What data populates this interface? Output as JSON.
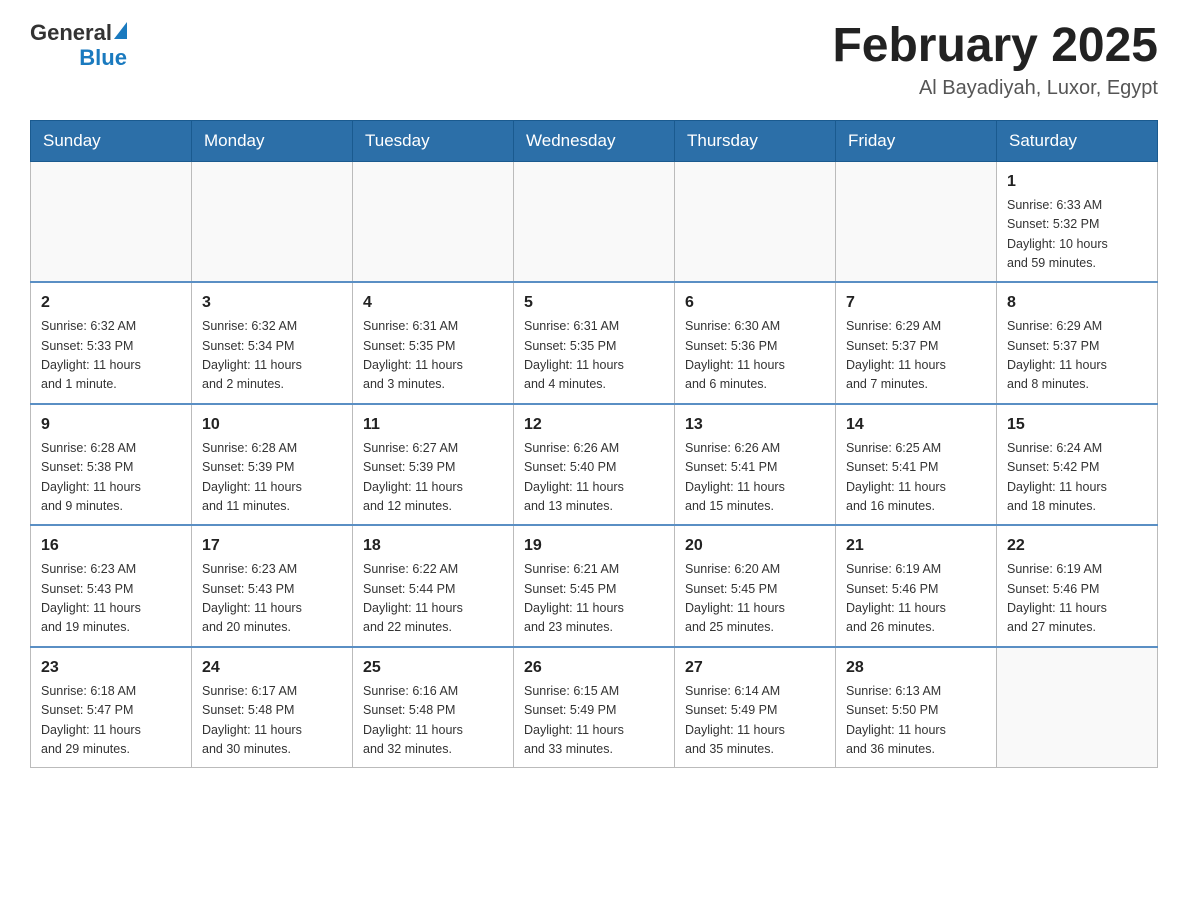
{
  "logo": {
    "general": "General",
    "blue": "Blue"
  },
  "title": {
    "month": "February 2025",
    "location": "Al Bayadiyah, Luxor, Egypt"
  },
  "weekdays": [
    "Sunday",
    "Monday",
    "Tuesday",
    "Wednesday",
    "Thursday",
    "Friday",
    "Saturday"
  ],
  "weeks": [
    [
      {
        "day": "",
        "info": ""
      },
      {
        "day": "",
        "info": ""
      },
      {
        "day": "",
        "info": ""
      },
      {
        "day": "",
        "info": ""
      },
      {
        "day": "",
        "info": ""
      },
      {
        "day": "",
        "info": ""
      },
      {
        "day": "1",
        "info": "Sunrise: 6:33 AM\nSunset: 5:32 PM\nDaylight: 10 hours\nand 59 minutes."
      }
    ],
    [
      {
        "day": "2",
        "info": "Sunrise: 6:32 AM\nSunset: 5:33 PM\nDaylight: 11 hours\nand 1 minute."
      },
      {
        "day": "3",
        "info": "Sunrise: 6:32 AM\nSunset: 5:34 PM\nDaylight: 11 hours\nand 2 minutes."
      },
      {
        "day": "4",
        "info": "Sunrise: 6:31 AM\nSunset: 5:35 PM\nDaylight: 11 hours\nand 3 minutes."
      },
      {
        "day": "5",
        "info": "Sunrise: 6:31 AM\nSunset: 5:35 PM\nDaylight: 11 hours\nand 4 minutes."
      },
      {
        "day": "6",
        "info": "Sunrise: 6:30 AM\nSunset: 5:36 PM\nDaylight: 11 hours\nand 6 minutes."
      },
      {
        "day": "7",
        "info": "Sunrise: 6:29 AM\nSunset: 5:37 PM\nDaylight: 11 hours\nand 7 minutes."
      },
      {
        "day": "8",
        "info": "Sunrise: 6:29 AM\nSunset: 5:37 PM\nDaylight: 11 hours\nand 8 minutes."
      }
    ],
    [
      {
        "day": "9",
        "info": "Sunrise: 6:28 AM\nSunset: 5:38 PM\nDaylight: 11 hours\nand 9 minutes."
      },
      {
        "day": "10",
        "info": "Sunrise: 6:28 AM\nSunset: 5:39 PM\nDaylight: 11 hours\nand 11 minutes."
      },
      {
        "day": "11",
        "info": "Sunrise: 6:27 AM\nSunset: 5:39 PM\nDaylight: 11 hours\nand 12 minutes."
      },
      {
        "day": "12",
        "info": "Sunrise: 6:26 AM\nSunset: 5:40 PM\nDaylight: 11 hours\nand 13 minutes."
      },
      {
        "day": "13",
        "info": "Sunrise: 6:26 AM\nSunset: 5:41 PM\nDaylight: 11 hours\nand 15 minutes."
      },
      {
        "day": "14",
        "info": "Sunrise: 6:25 AM\nSunset: 5:41 PM\nDaylight: 11 hours\nand 16 minutes."
      },
      {
        "day": "15",
        "info": "Sunrise: 6:24 AM\nSunset: 5:42 PM\nDaylight: 11 hours\nand 18 minutes."
      }
    ],
    [
      {
        "day": "16",
        "info": "Sunrise: 6:23 AM\nSunset: 5:43 PM\nDaylight: 11 hours\nand 19 minutes."
      },
      {
        "day": "17",
        "info": "Sunrise: 6:23 AM\nSunset: 5:43 PM\nDaylight: 11 hours\nand 20 minutes."
      },
      {
        "day": "18",
        "info": "Sunrise: 6:22 AM\nSunset: 5:44 PM\nDaylight: 11 hours\nand 22 minutes."
      },
      {
        "day": "19",
        "info": "Sunrise: 6:21 AM\nSunset: 5:45 PM\nDaylight: 11 hours\nand 23 minutes."
      },
      {
        "day": "20",
        "info": "Sunrise: 6:20 AM\nSunset: 5:45 PM\nDaylight: 11 hours\nand 25 minutes."
      },
      {
        "day": "21",
        "info": "Sunrise: 6:19 AM\nSunset: 5:46 PM\nDaylight: 11 hours\nand 26 minutes."
      },
      {
        "day": "22",
        "info": "Sunrise: 6:19 AM\nSunset: 5:46 PM\nDaylight: 11 hours\nand 27 minutes."
      }
    ],
    [
      {
        "day": "23",
        "info": "Sunrise: 6:18 AM\nSunset: 5:47 PM\nDaylight: 11 hours\nand 29 minutes."
      },
      {
        "day": "24",
        "info": "Sunrise: 6:17 AM\nSunset: 5:48 PM\nDaylight: 11 hours\nand 30 minutes."
      },
      {
        "day": "25",
        "info": "Sunrise: 6:16 AM\nSunset: 5:48 PM\nDaylight: 11 hours\nand 32 minutes."
      },
      {
        "day": "26",
        "info": "Sunrise: 6:15 AM\nSunset: 5:49 PM\nDaylight: 11 hours\nand 33 minutes."
      },
      {
        "day": "27",
        "info": "Sunrise: 6:14 AM\nSunset: 5:49 PM\nDaylight: 11 hours\nand 35 minutes."
      },
      {
        "day": "28",
        "info": "Sunrise: 6:13 AM\nSunset: 5:50 PM\nDaylight: 11 hours\nand 36 minutes."
      },
      {
        "day": "",
        "info": ""
      }
    ]
  ]
}
